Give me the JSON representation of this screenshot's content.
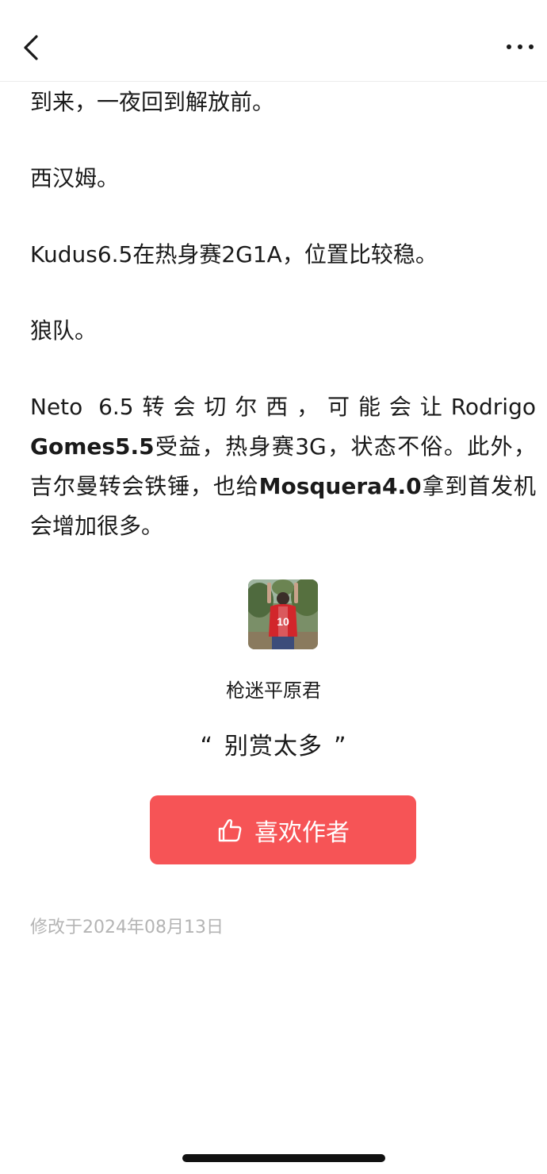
{
  "nav": {
    "back_icon": "chevron-left-icon",
    "more_icon": "more-horizontal-icon"
  },
  "article": {
    "para1": "到来，一夜回到解放前。",
    "para2": "西汉姆。",
    "para3": "Kudus6.5在热身赛2G1A，位置比较稳。",
    "para4": "狼队。",
    "para5": {
      "t1": "Neto 6.5转会切尔西，可能会让Rodrigo ",
      "b1": "Gomes5.5",
      "t2": "受益，热身赛3G，状态不俗。此外，吉尔曼转会铁锤，也给",
      "b2": "Mosquera4.0",
      "t3": "拿到首发机会增加很多。"
    }
  },
  "author": {
    "avatar": "author-avatar",
    "name": "枪迷平原君"
  },
  "reward": {
    "open_quote": "“",
    "text": "别赏太多",
    "close_quote": "”"
  },
  "like_button": {
    "icon": "thumbs-up-icon",
    "label": "喜欢作者"
  },
  "footer": {
    "modified": "修改于2024年08月13日"
  },
  "colors": {
    "accent": "#f65456",
    "muted_text": "#b4b4b4",
    "divider": "#ececec"
  }
}
